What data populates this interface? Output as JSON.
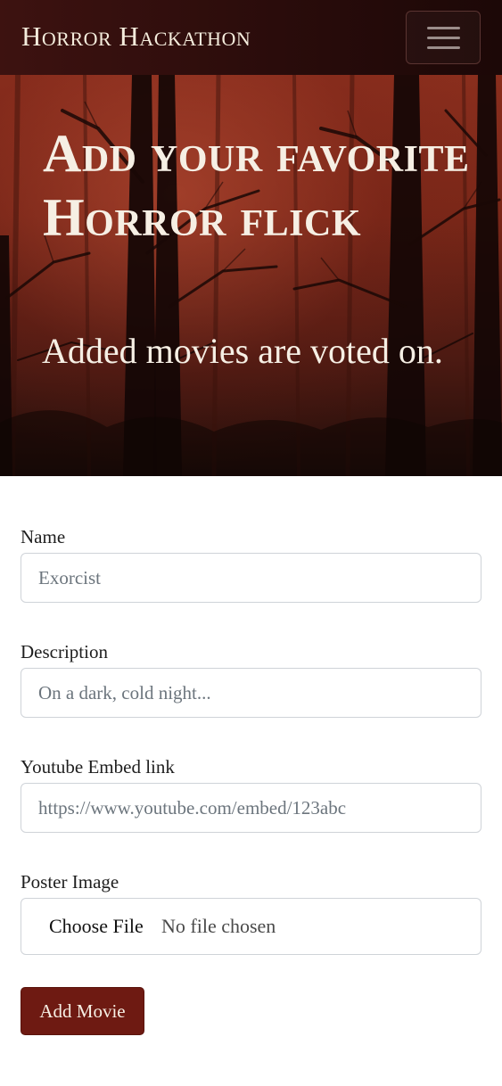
{
  "navbar": {
    "brand": "Horror Hackathon",
    "toggle_icon": "hamburger-menu-icon"
  },
  "hero": {
    "title": "Add your favorite Horror flick",
    "subtitle": "Added movies are voted on."
  },
  "form": {
    "name": {
      "label": "Name",
      "placeholder": "Exorcist",
      "value": ""
    },
    "description": {
      "label": "Description",
      "placeholder": "On a dark, cold night...",
      "value": ""
    },
    "youtube": {
      "label": "Youtube Embed link",
      "placeholder": "https://www.youtube.com/embed/123abc",
      "value": ""
    },
    "poster": {
      "label": "Poster Image",
      "button_label": "Choose File",
      "status": "No file chosen"
    },
    "submit_label": "Add Movie"
  },
  "colors": {
    "navbar_bg": "#2a0c0b",
    "hero_bg": "#7a2718",
    "submit_bg": "#6e1a12",
    "hero_text": "#f6efe4"
  }
}
